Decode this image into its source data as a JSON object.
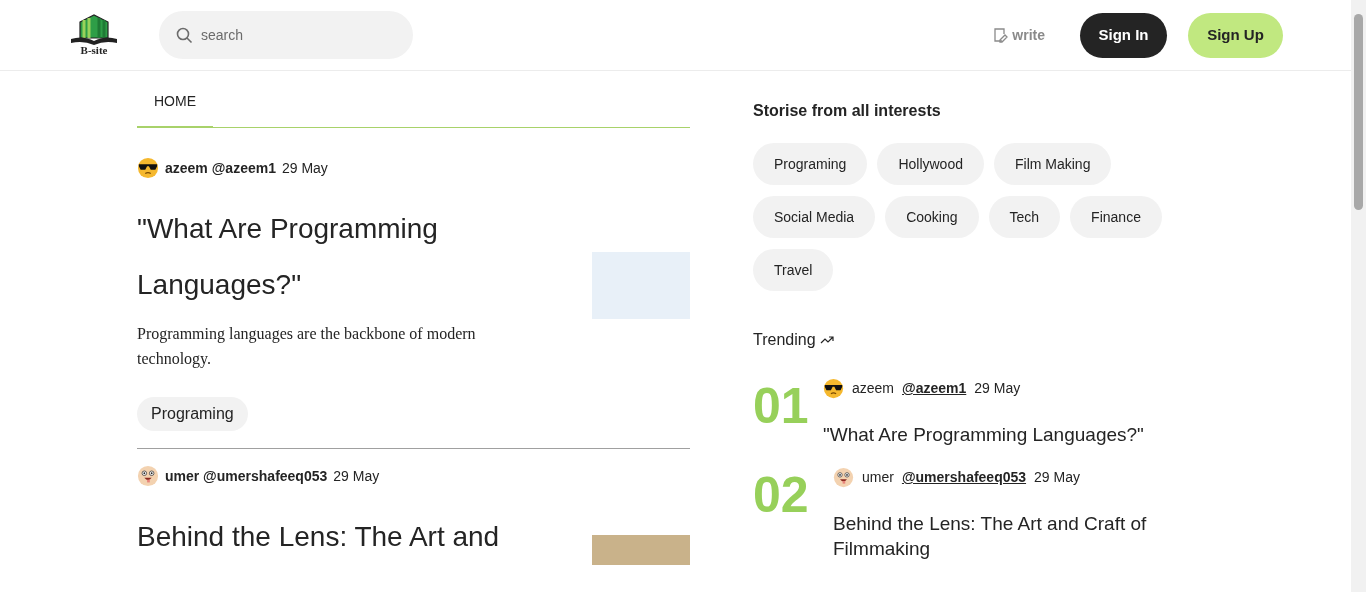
{
  "header": {
    "logo_text": "B-site",
    "search": {
      "placeholder": "search"
    },
    "write_label": "write",
    "sign_in": "Sign In",
    "sign_up": "Sign Up"
  },
  "tabs": [
    {
      "label": "HOME",
      "selected": true
    }
  ],
  "posts": [
    {
      "author": "azeem @azeem1",
      "date": "29 May",
      "avatar": {
        "kind": "sunglasses"
      },
      "title": "\"What Are Programming Languages?\"",
      "excerpt": "Programming languages are the backbone of modern technology.",
      "tag": "Programing",
      "thumbnail": {
        "kind": "word-cloud"
      }
    },
    {
      "author": "umer @umershafeeq053",
      "date": "29 May",
      "avatar": {
        "kind": "silly"
      },
      "title": "Behind the Lens: The Art and",
      "thumbnail": {
        "kind": "photo"
      }
    }
  ],
  "interests": {
    "title": "Storise from all interests",
    "topics": [
      "Programing",
      "Hollywood",
      "Film Making",
      "Social Media",
      "Cooking",
      "Tech",
      "Finance",
      "Travel"
    ]
  },
  "trending": {
    "title": "Trending",
    "items": [
      {
        "rank": "01",
        "name": "azeem",
        "handle": "@azeem1",
        "date": "29 May",
        "avatar": {
          "kind": "sunglasses"
        },
        "title": "\"What Are Programming Languages?\""
      },
      {
        "rank": "02",
        "name": "umer",
        "handle": "@umershafeeq053",
        "date": "29 May",
        "avatar": {
          "kind": "silly"
        },
        "title": "Behind the Lens: The Art and Craft of Filmmaking"
      }
    ]
  }
}
